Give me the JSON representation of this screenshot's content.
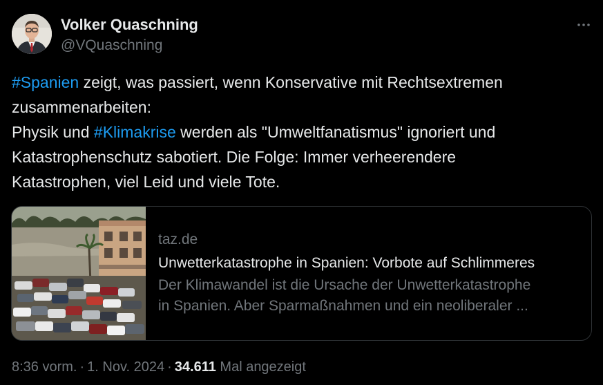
{
  "author": {
    "display_name": "Volker Quaschning",
    "handle": "@VQuaschning"
  },
  "tweet": {
    "line1": {
      "hashtag": "#Spanien",
      "rest": " zeigt, was passiert, wenn Konservative mit Rechtsextremen"
    },
    "line2": "zusammenarbeiten:",
    "line3": {
      "before": "Physik und ",
      "hashtag": "#Klimakrise",
      "after": " werden als \"Umweltfanatismus\" ignoriert und"
    },
    "line4": "Katastrophenschutz sabotiert. Die Folge: Immer verheerendere",
    "line5": "Katastrophen, viel Leid und viele Tote."
  },
  "link_card": {
    "domain": "taz.de",
    "title": "Unwetterkatastrophe in Spanien: Vorbote auf Schlimmeres",
    "description_line1": "Der Klimawandel ist die Ursache der Unwetterkatastrophe",
    "description_line2": "in Spanien. Aber Sparmaßnahmen und ein neoliberaler ..."
  },
  "meta": {
    "time": "8:36 vorm.",
    "date": "1. Nov. 2024",
    "views_count": "34.611",
    "views_label": "Mal angezeigt",
    "separator": "·"
  },
  "icons": {
    "more": "more-horizontal-icon"
  },
  "colors": {
    "background": "#000000",
    "text_primary": "#e7e9ea",
    "text_secondary": "#71767b",
    "link": "#1d9bf0",
    "border": "#2f3336"
  }
}
